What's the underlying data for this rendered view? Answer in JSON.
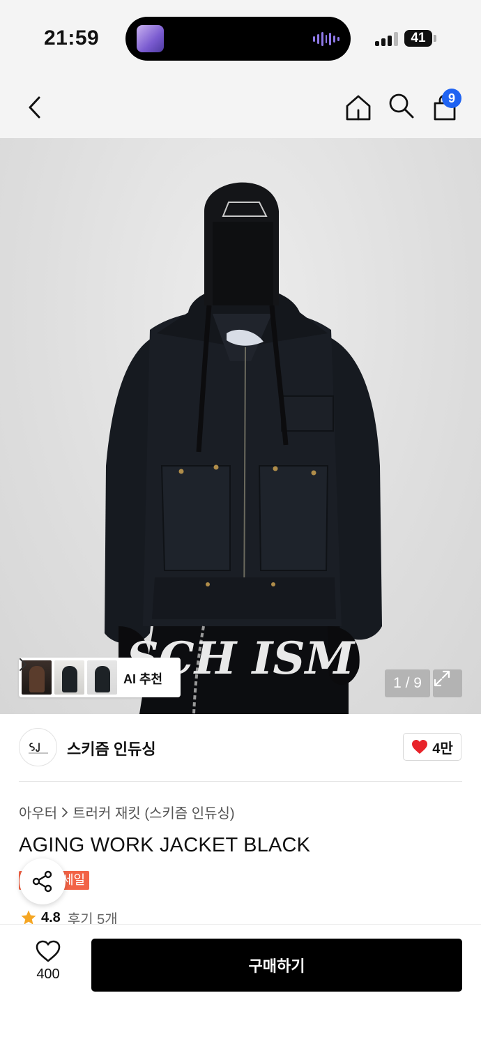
{
  "status_bar": {
    "time": "21:59",
    "battery": "41"
  },
  "nav": {
    "back_icon": "chevron-left-icon",
    "home_icon": "home-icon",
    "search_icon": "search-icon",
    "bag_icon": "shopping-bag-icon",
    "cart_count": "9"
  },
  "product_image": {
    "chest_print": "SCH ISM",
    "ai_recommend_label": "AI 추천",
    "page_indicator": "1 / 9",
    "expand_icon": "expand-icon"
  },
  "brand": {
    "name": "스키즘 인듀싱",
    "likes": "4만",
    "heart_color": "#e8232a"
  },
  "breadcrumb": {
    "category": "아우터",
    "subcategory": "트러커 재킷 (스키즘 인듀싱)"
  },
  "product": {
    "title": "AGING WORK JACKET BLACK",
    "sale_badge": "세일",
    "rating": "4.8",
    "reviews": "후기 5개"
  },
  "bottom_bar": {
    "wish_count": "400",
    "buy_label": "구매하기"
  },
  "colors": {
    "accent_blue": "#1f63f2",
    "sale_red": "#f26346",
    "star": "#f5a623",
    "buy_button": "#000000"
  }
}
